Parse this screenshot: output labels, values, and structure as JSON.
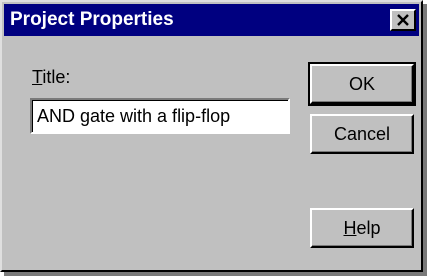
{
  "dialog": {
    "title": "Project Properties",
    "close_icon": "close-icon"
  },
  "form": {
    "title_label_mnemonic": "T",
    "title_label_rest": "itle:",
    "title_value": "AND gate with a flip-flop"
  },
  "buttons": {
    "ok_label": "OK",
    "cancel_label": "Cancel",
    "help_label_mnemonic": "H",
    "help_label_rest": "elp"
  },
  "colors": {
    "titlebar": "#000080",
    "face": "#c0c0c0"
  }
}
